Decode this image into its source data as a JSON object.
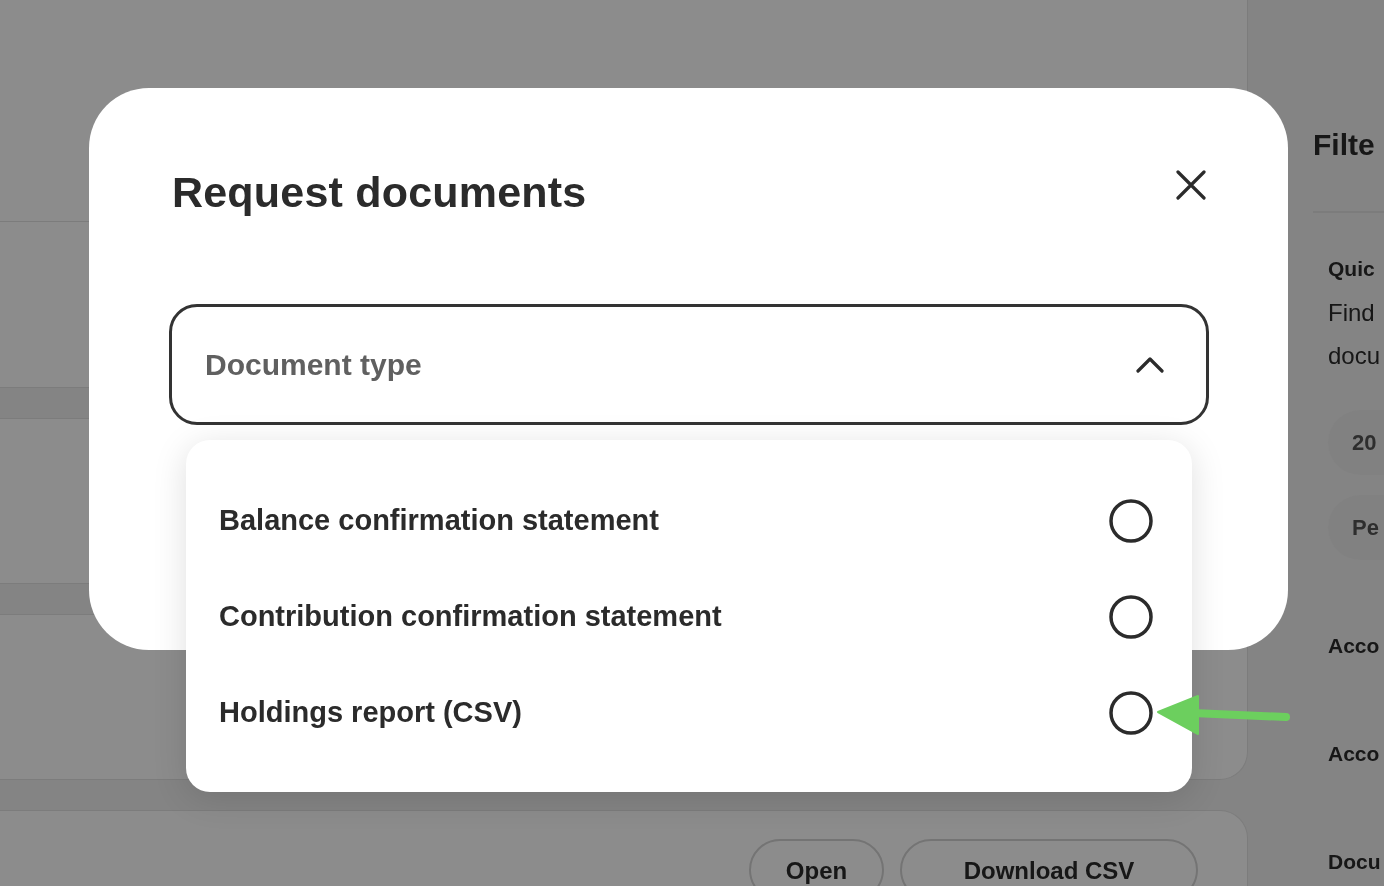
{
  "modal": {
    "title": "Request documents",
    "document_type": {
      "placeholder": "Document type",
      "expanded": true,
      "options": [
        {
          "label": "Balance confirmation statement",
          "selected": false
        },
        {
          "label": "Contribution confirmation statement",
          "selected": false
        },
        {
          "label": "Holdings report (CSV)",
          "selected": false
        }
      ]
    }
  },
  "document_card": {
    "buttons": [
      "Open",
      "Download CSV"
    ]
  },
  "filter_panel": {
    "title": "Filte",
    "quick_filter": {
      "heading": "Quic",
      "description": "Find docu",
      "chips": [
        "20",
        "Pe"
      ]
    },
    "sections": [
      "Acco",
      "Acco",
      "Docu"
    ]
  }
}
